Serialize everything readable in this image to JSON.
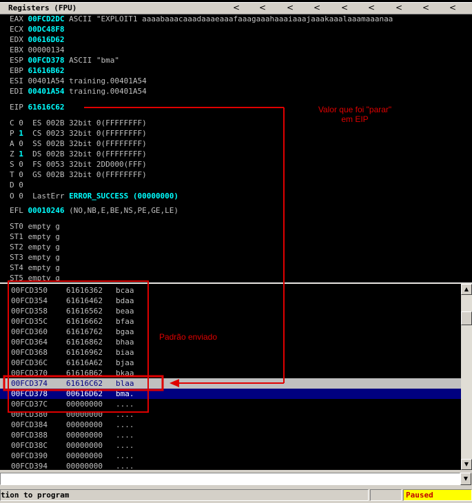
{
  "registers": {
    "title": "Registers (FPU)",
    "arrows": [
      "<",
      "<",
      "<",
      "<",
      "<",
      "<",
      "<",
      "<",
      "<"
    ],
    "rows": [
      {
        "id": "eax",
        "name": "EAX",
        "value": "00FCD2DC",
        "rest": " ASCII \"EXPLOIT1 aaaabaaacaaadaaaeaaafaaagaaahaaaiaaajaaakaaalaaamaaanaa",
        "hl": true
      },
      {
        "id": "ecx",
        "name": "ECX",
        "value": "00DC48F8",
        "rest": "",
        "hl": true
      },
      {
        "id": "edx",
        "name": "EDX",
        "value": "00616D62",
        "rest": "",
        "hl": true
      },
      {
        "id": "ebx",
        "name": "EBX",
        "value": "00000134",
        "rest": "",
        "hl": false
      },
      {
        "id": "esp",
        "name": "ESP",
        "value": "00FCD378",
        "rest": " ASCII \"bma\"",
        "hl": true
      },
      {
        "id": "ebp",
        "name": "EBP",
        "value": "61616B62",
        "rest": "",
        "hl": true
      },
      {
        "id": "esi",
        "name": "ESI",
        "value": "00401A54",
        "rest": " training.00401A54",
        "hl": false
      },
      {
        "id": "edi",
        "name": "EDI",
        "value": "00401A54",
        "rest": " training.00401A54",
        "hl": true
      }
    ],
    "eip": {
      "name": "EIP",
      "value": "61616C62"
    },
    "flags": [
      {
        "id": "c",
        "flag": "C",
        "bit": "0",
        "hl": false,
        "seg": "ES 002B 32bit 0(FFFFFFFF)"
      },
      {
        "id": "p",
        "flag": "P",
        "bit": "1",
        "hl": true,
        "seg": "CS 0023 32bit 0(FFFFFFFF)"
      },
      {
        "id": "a",
        "flag": "A",
        "bit": "0",
        "hl": false,
        "seg": "SS 002B 32bit 0(FFFFFFFF)"
      },
      {
        "id": "z",
        "flag": "Z",
        "bit": "1",
        "hl": true,
        "seg": "DS 002B 32bit 0(FFFFFFFF)"
      },
      {
        "id": "s",
        "flag": "S",
        "bit": "0",
        "hl": false,
        "seg": "FS 0053 32bit 2DD000(FFF)"
      },
      {
        "id": "t",
        "flag": "T",
        "bit": "0",
        "hl": false,
        "seg": "GS 002B 32bit 0(FFFFFFFF)"
      },
      {
        "id": "d",
        "flag": "D",
        "bit": "0",
        "hl": false,
        "seg": ""
      }
    ],
    "lasterr": {
      "flag": "O",
      "bit": "0",
      "label": "LastErr",
      "value": "ERROR_SUCCESS (00000000)"
    },
    "efl": {
      "name": "EFL",
      "value": "00010246",
      "rest": " (NO,NB,E,BE,NS,PE,GE,LE)"
    },
    "fpu": [
      {
        "id": "st0",
        "text": "ST0 empty g"
      },
      {
        "id": "st1",
        "text": "ST1 empty g"
      },
      {
        "id": "st2",
        "text": "ST2 empty g"
      },
      {
        "id": "st3",
        "text": "ST3 empty g"
      },
      {
        "id": "st4",
        "text": "ST4 empty g"
      },
      {
        "id": "st5",
        "text": "ST5 empty g"
      }
    ]
  },
  "stack": {
    "rows": [
      {
        "addr": "00FCD350",
        "val": "61616362",
        "cmt": "bcaa",
        "state": "normal"
      },
      {
        "addr": "00FCD354",
        "val": "61616462",
        "cmt": "bdaa",
        "state": "normal"
      },
      {
        "addr": "00FCD358",
        "val": "61616562",
        "cmt": "beaa",
        "state": "normal"
      },
      {
        "addr": "00FCD35C",
        "val": "61616662",
        "cmt": "bfaa",
        "state": "normal"
      },
      {
        "addr": "00FCD360",
        "val": "61616762",
        "cmt": "bgaa",
        "state": "normal"
      },
      {
        "addr": "00FCD364",
        "val": "61616862",
        "cmt": "bhaa",
        "state": "normal"
      },
      {
        "addr": "00FCD368",
        "val": "61616962",
        "cmt": "biaa",
        "state": "normal"
      },
      {
        "addr": "00FCD36C",
        "val": "61616A62",
        "cmt": "bjaa",
        "state": "normal"
      },
      {
        "addr": "00FCD370",
        "val": "61616B62",
        "cmt": "bkaa",
        "state": "normal"
      },
      {
        "addr": "00FCD374",
        "val": "61616C62",
        "cmt": "blaa",
        "state": "greyrow"
      },
      {
        "addr": "00FCD378",
        "val": "00616D62",
        "cmt": "bma.",
        "state": "selected"
      },
      {
        "addr": "00FCD37C",
        "val": "00000000",
        "cmt": "....",
        "state": "normal"
      },
      {
        "addr": "00FCD380",
        "val": "00000000",
        "cmt": "....",
        "state": "normal"
      },
      {
        "addr": "00FCD384",
        "val": "00000000",
        "cmt": "....",
        "state": "normal"
      },
      {
        "addr": "00FCD388",
        "val": "00000000",
        "cmt": "....",
        "state": "normal"
      },
      {
        "addr": "00FCD38C",
        "val": "00000000",
        "cmt": "....",
        "state": "normal"
      },
      {
        "addr": "00FCD390",
        "val": "00000000",
        "cmt": "....",
        "state": "normal"
      },
      {
        "addr": "00FCD394",
        "val": "00000000",
        "cmt": "....",
        "state": "normal"
      }
    ]
  },
  "annotations": {
    "eip_note_line1": "Valor que foi \"parar\"",
    "eip_note_line2": "em EIP",
    "pattern_note": "Padrão enviado",
    "color": "#e00000"
  },
  "command": {
    "value": "",
    "placeholder": ""
  },
  "status": {
    "text": "tion to program",
    "state": "Paused"
  },
  "colors": {
    "highlight": "#00ffff",
    "selection": "#000080",
    "status_bg": "#ffff00",
    "status_fg": "#c00000"
  }
}
